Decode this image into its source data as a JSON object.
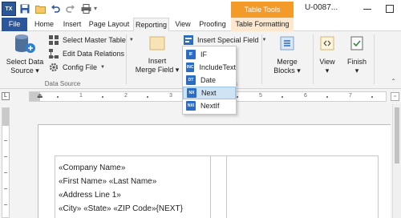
{
  "titlebar": {
    "app_icon_text": "TX",
    "context_tab_header": "Table Tools",
    "doc_title": "U-0087..."
  },
  "tabs": [
    {
      "label": "File"
    },
    {
      "label": "Home"
    },
    {
      "label": "Insert"
    },
    {
      "label": "Page Layout"
    },
    {
      "label": "Reporting"
    },
    {
      "label": "View"
    },
    {
      "label": "Proofing"
    },
    {
      "label": "Table Formatting"
    }
  ],
  "ribbon": {
    "select_data_source": {
      "line1": "Select Data",
      "line2": "Source ▾"
    },
    "select_master_table": "Select Master Table",
    "edit_data_relations": "Edit Data Relations",
    "config_file": "Config File",
    "data_source_group": "Data Source",
    "insert_merge_field": {
      "line1": "Insert",
      "line2": "Merge Field ▾"
    },
    "insert_special_field": "Insert Special Field",
    "fields_group_fragment": "es",
    "merge_blocks": {
      "line1": "Merge",
      "line2": "Blocks ▾"
    },
    "view": {
      "line1": "View",
      "line2": "▾"
    },
    "finish": {
      "line1": "Finish",
      "line2": "▾"
    }
  },
  "dropdown": {
    "items": [
      {
        "label": "IF",
        "icon_text": "IF"
      },
      {
        "label": "IncludeText",
        "icon_text": "INC"
      },
      {
        "label": "Date",
        "icon_text": "DT"
      },
      {
        "label": "Next",
        "icon_text": "NX"
      },
      {
        "label": "NextIf",
        "icon_text": "NXI"
      }
    ],
    "highlighted_index": 3
  },
  "ruler": {
    "corner": "L",
    "numbers": [
      "1",
      "2",
      "3",
      "4",
      "5",
      "6",
      "7"
    ]
  },
  "document": {
    "lines": [
      "«Company Name»",
      "«First Name» «Last Name»",
      "«Address Line 1»",
      "«City» «State» «ZIP Code»{NEXT}"
    ]
  },
  "colors": {
    "file_tab": "#2b579a",
    "context_header": "#f39a29",
    "context_tab_bg": "#fde8cf",
    "highlight": "#cfe3f5",
    "dd_icon": "#2b6cc4"
  }
}
